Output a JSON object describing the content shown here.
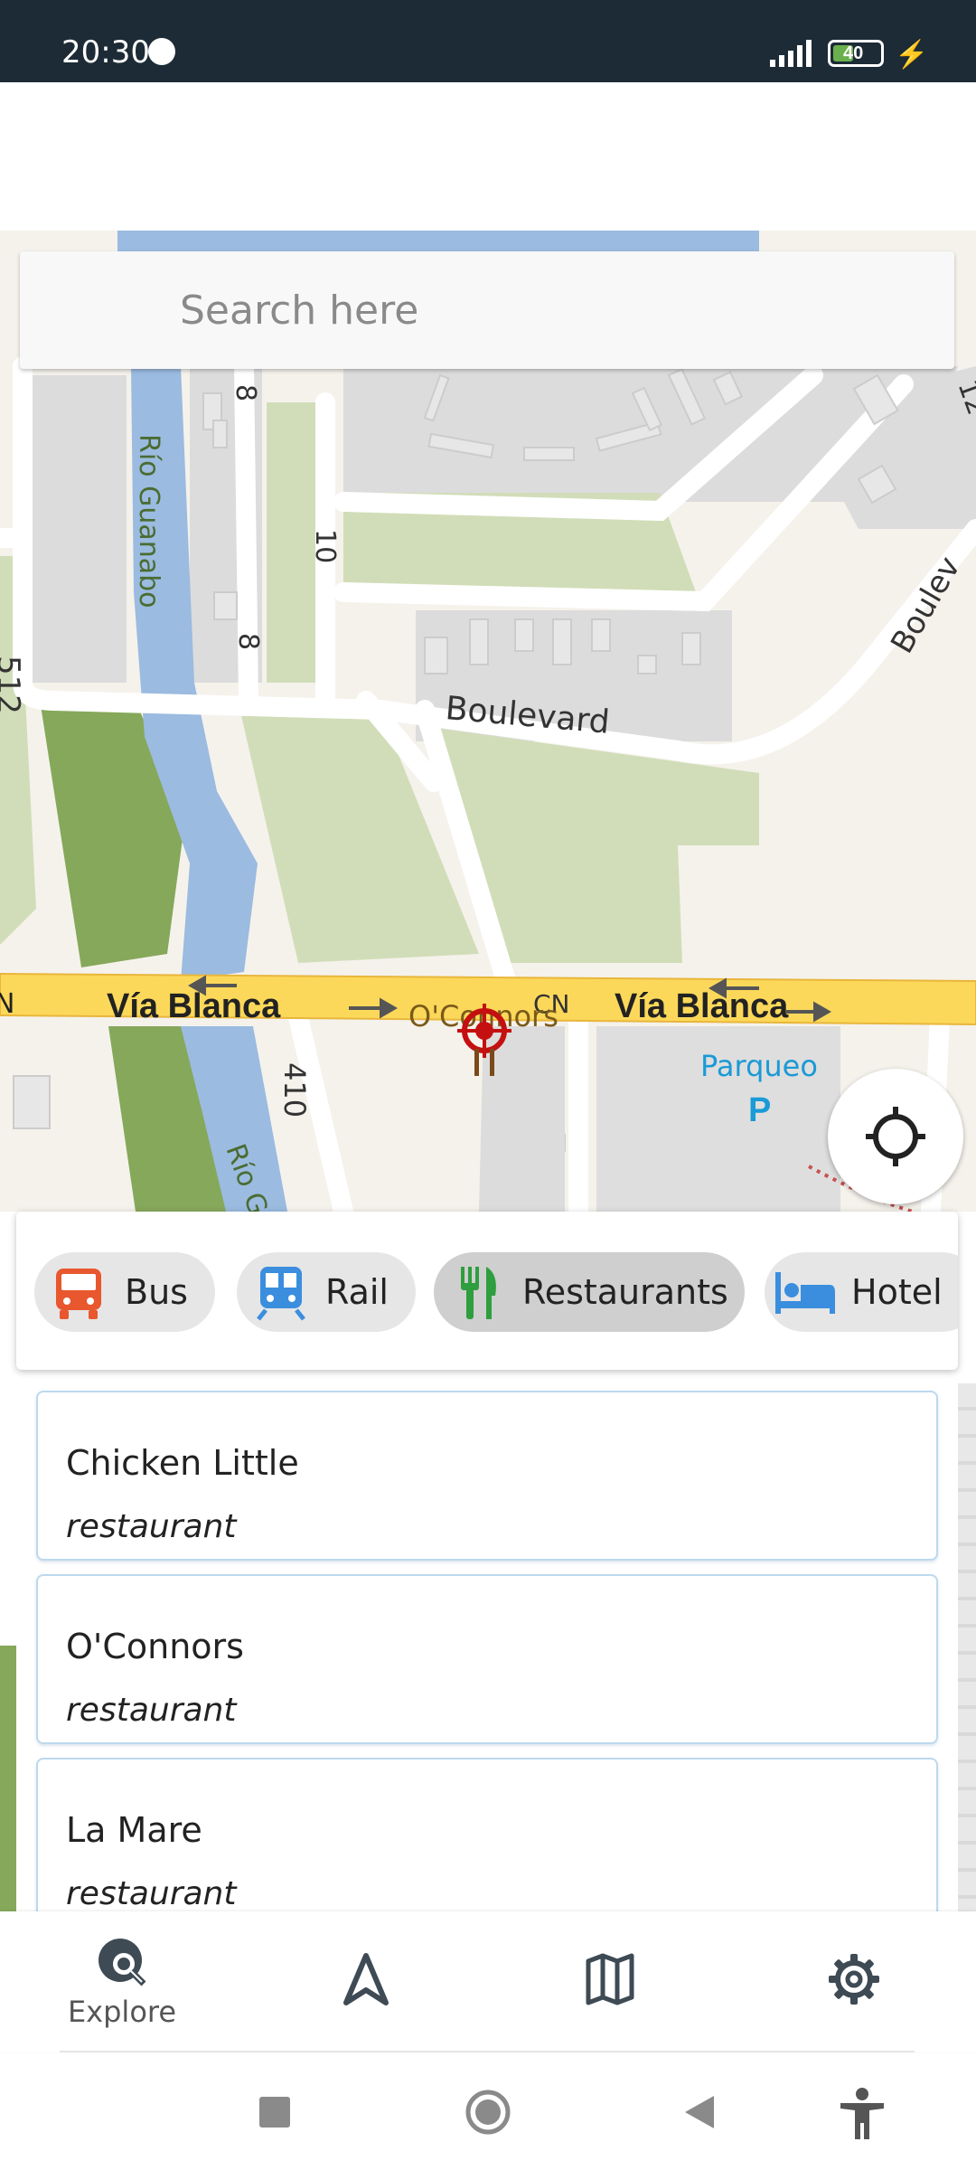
{
  "status_bar": {
    "time": "20:30",
    "battery_level": "40",
    "icons": [
      "notification-dot-icon",
      "signal-icon",
      "battery-icon",
      "charging-bolt-icon"
    ]
  },
  "search": {
    "placeholder": "Search here",
    "value": ""
  },
  "map": {
    "labels": {
      "road_512": "512",
      "rio_guanabo": "Río Guanabo",
      "road_8a": "8",
      "road_10": "10",
      "road_8b": "8",
      "boulevard": "Boulevard",
      "boulevard_partial": "Boulev",
      "via_blanca_1": "Vía Blanca",
      "via_blanca_2": "Vía Blanca",
      "oconnors": "O'Connors",
      "cn": "CN",
      "road_410": "410",
      "rio_partial": "Río G",
      "parqueo": "Parqueo",
      "parking_p": "P",
      "road_12": "12",
      "n_edge": "N"
    }
  },
  "categories": [
    {
      "label": "Bus",
      "icon": "bus-icon",
      "color": "#e8572e"
    },
    {
      "label": "Rail",
      "icon": "train-icon",
      "color": "#3b8ede"
    },
    {
      "label": "Restaurants",
      "icon": "fork-knife-icon",
      "color": "#2e9e3e",
      "selected": true
    },
    {
      "label": "Hotel",
      "icon": "bed-icon",
      "color": "#3b8ede"
    }
  ],
  "results": [
    {
      "name": "Chicken Little",
      "type": "restaurant"
    },
    {
      "name": "O'Connors",
      "type": "restaurant"
    },
    {
      "name": "La Mare",
      "type": "restaurant"
    }
  ],
  "bottom_nav": {
    "items": [
      {
        "label": "Explore",
        "icon": "explore-icon",
        "active": true
      },
      {
        "label": "",
        "icon": "navigation-icon"
      },
      {
        "label": "",
        "icon": "map-icon"
      },
      {
        "label": "",
        "icon": "gear-icon"
      }
    ]
  },
  "system_nav": {
    "icons": [
      "recents-square-icon",
      "home-circle-icon",
      "back-triangle-icon",
      "accessibility-icon"
    ]
  },
  "colors": {
    "status_bar_bg": "#1c2b36",
    "road_major": "#fcd85a",
    "water": "#9bbbe0",
    "park": "#d1ddb8",
    "forest": "#86a85a",
    "building": "#dcdcdc",
    "poi_red": "#c41010",
    "parking_blue": "#1a9ad6"
  }
}
